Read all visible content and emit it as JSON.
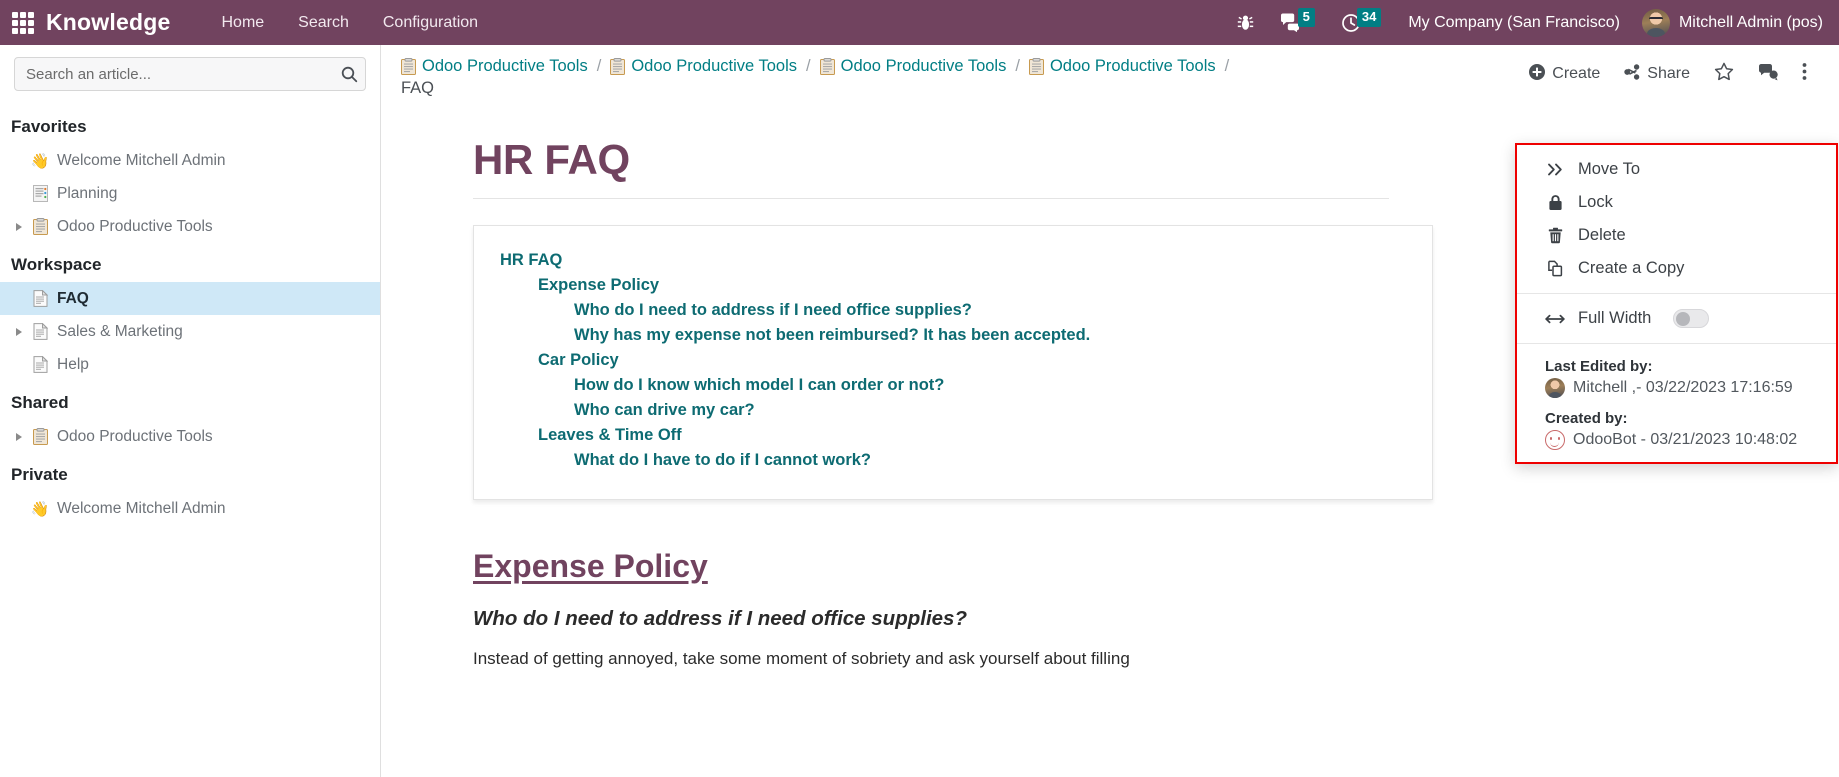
{
  "navbar": {
    "apps_icon": "apps-grid-icon",
    "brand": "Knowledge",
    "menu": [
      {
        "label": "Home"
      },
      {
        "label": "Search"
      },
      {
        "label": "Configuration"
      }
    ],
    "bug_icon": "bug-icon",
    "messages_icon": "messages-icon",
    "messages_count": "5",
    "activities_icon": "clock-icon",
    "activities_count": "34",
    "company": "My Company (San Francisco)",
    "user": "Mitchell Admin (pos)",
    "avatar_icon": "user-avatar",
    "brand_color": "#71435f",
    "badge_color": "#017e84"
  },
  "sidebar": {
    "search": {
      "placeholder": "Search an article...",
      "value": "",
      "icon": "search-icon"
    },
    "sections": [
      {
        "title": "Favorites",
        "items": [
          {
            "label": "Welcome Mitchell Admin",
            "icon": "waving-hand-emoji",
            "caret": false,
            "active": false
          },
          {
            "label": "Planning",
            "icon": "article-doc-icon",
            "caret": false,
            "active": false
          },
          {
            "label": "Odoo Productive Tools",
            "icon": "clipboard-icon",
            "caret": true,
            "active": false
          }
        ]
      },
      {
        "title": "Workspace",
        "items": [
          {
            "label": "FAQ",
            "icon": "article-doc-icon",
            "caret": false,
            "active": true
          },
          {
            "label": "Sales & Marketing",
            "icon": "article-doc-icon",
            "caret": true,
            "active": false
          },
          {
            "label": "Help",
            "icon": "article-doc-icon",
            "caret": false,
            "active": false
          }
        ]
      },
      {
        "title": "Shared",
        "items": [
          {
            "label": "Odoo Productive Tools",
            "icon": "clipboard-icon",
            "caret": true,
            "active": false
          }
        ]
      },
      {
        "title": "Private",
        "items": [
          {
            "label": "Welcome Mitchell Admin",
            "icon": "waving-hand-emoji",
            "caret": false,
            "active": false
          }
        ]
      }
    ]
  },
  "breadcrumb": {
    "items": [
      {
        "label": "Odoo Productive Tools",
        "icon": "clipboard-icon",
        "last": false
      },
      {
        "label": "Odoo Productive Tools",
        "icon": "clipboard-icon",
        "last": false
      },
      {
        "label": "Odoo Productive Tools",
        "icon": "clipboard-icon",
        "last": false
      },
      {
        "label": "Odoo Productive Tools",
        "icon": "clipboard-icon",
        "last": false
      },
      {
        "label": "FAQ",
        "icon": "",
        "last": true
      }
    ],
    "separator": "/"
  },
  "actions": {
    "create": {
      "label": "Create",
      "icon": "plus-circle-icon"
    },
    "share": {
      "label": "Share",
      "icon": "share-icon"
    },
    "favorite": {
      "icon": "star-outline-icon"
    },
    "chatter": {
      "icon": "chat-bubble-icon"
    },
    "more": {
      "icon": "vertical-dots-icon"
    }
  },
  "dropdown": {
    "items": [
      {
        "label": "Move To",
        "icon": "chevrons-right-icon"
      },
      {
        "label": "Lock",
        "icon": "lock-icon"
      },
      {
        "label": "Delete",
        "icon": "trash-icon"
      },
      {
        "label": "Create a Copy",
        "icon": "copy-icon"
      }
    ],
    "full_width": {
      "label": "Full Width",
      "icon": "arrows-horizontal-icon",
      "enabled": false
    },
    "last_edited_label": "Last Edited by:",
    "last_edited_value": "Mitchell ,- 03/22/2023 17:16:59",
    "created_label": "Created by:",
    "created_value": "OdooBot - 03/21/2023 10:48:02",
    "highlight_color": "#ee0000"
  },
  "article": {
    "title": "HR FAQ",
    "toc": [
      {
        "label": "HR FAQ",
        "level": 0
      },
      {
        "label": "Expense Policy",
        "level": 1
      },
      {
        "label": "Who do I need to address if I need office supplies?",
        "level": 2
      },
      {
        "label": "Why has my expense not been reimbursed? It has been accepted.",
        "level": 2
      },
      {
        "label": "Car Policy",
        "level": 1
      },
      {
        "label": "How do I know which model I can order or not?",
        "level": 2
      },
      {
        "label": "Who can drive my car?",
        "level": 2
      },
      {
        "label": "Leaves & Time Off",
        "level": 1
      },
      {
        "label": "What do I have to do if I cannot work?",
        "level": 2
      }
    ],
    "section_heading": "Expense Policy",
    "sub_heading": "Who do I need to address if I need office supplies?",
    "paragraph": "Instead of getting annoyed, take some moment of sobriety and ask yourself about filling"
  }
}
